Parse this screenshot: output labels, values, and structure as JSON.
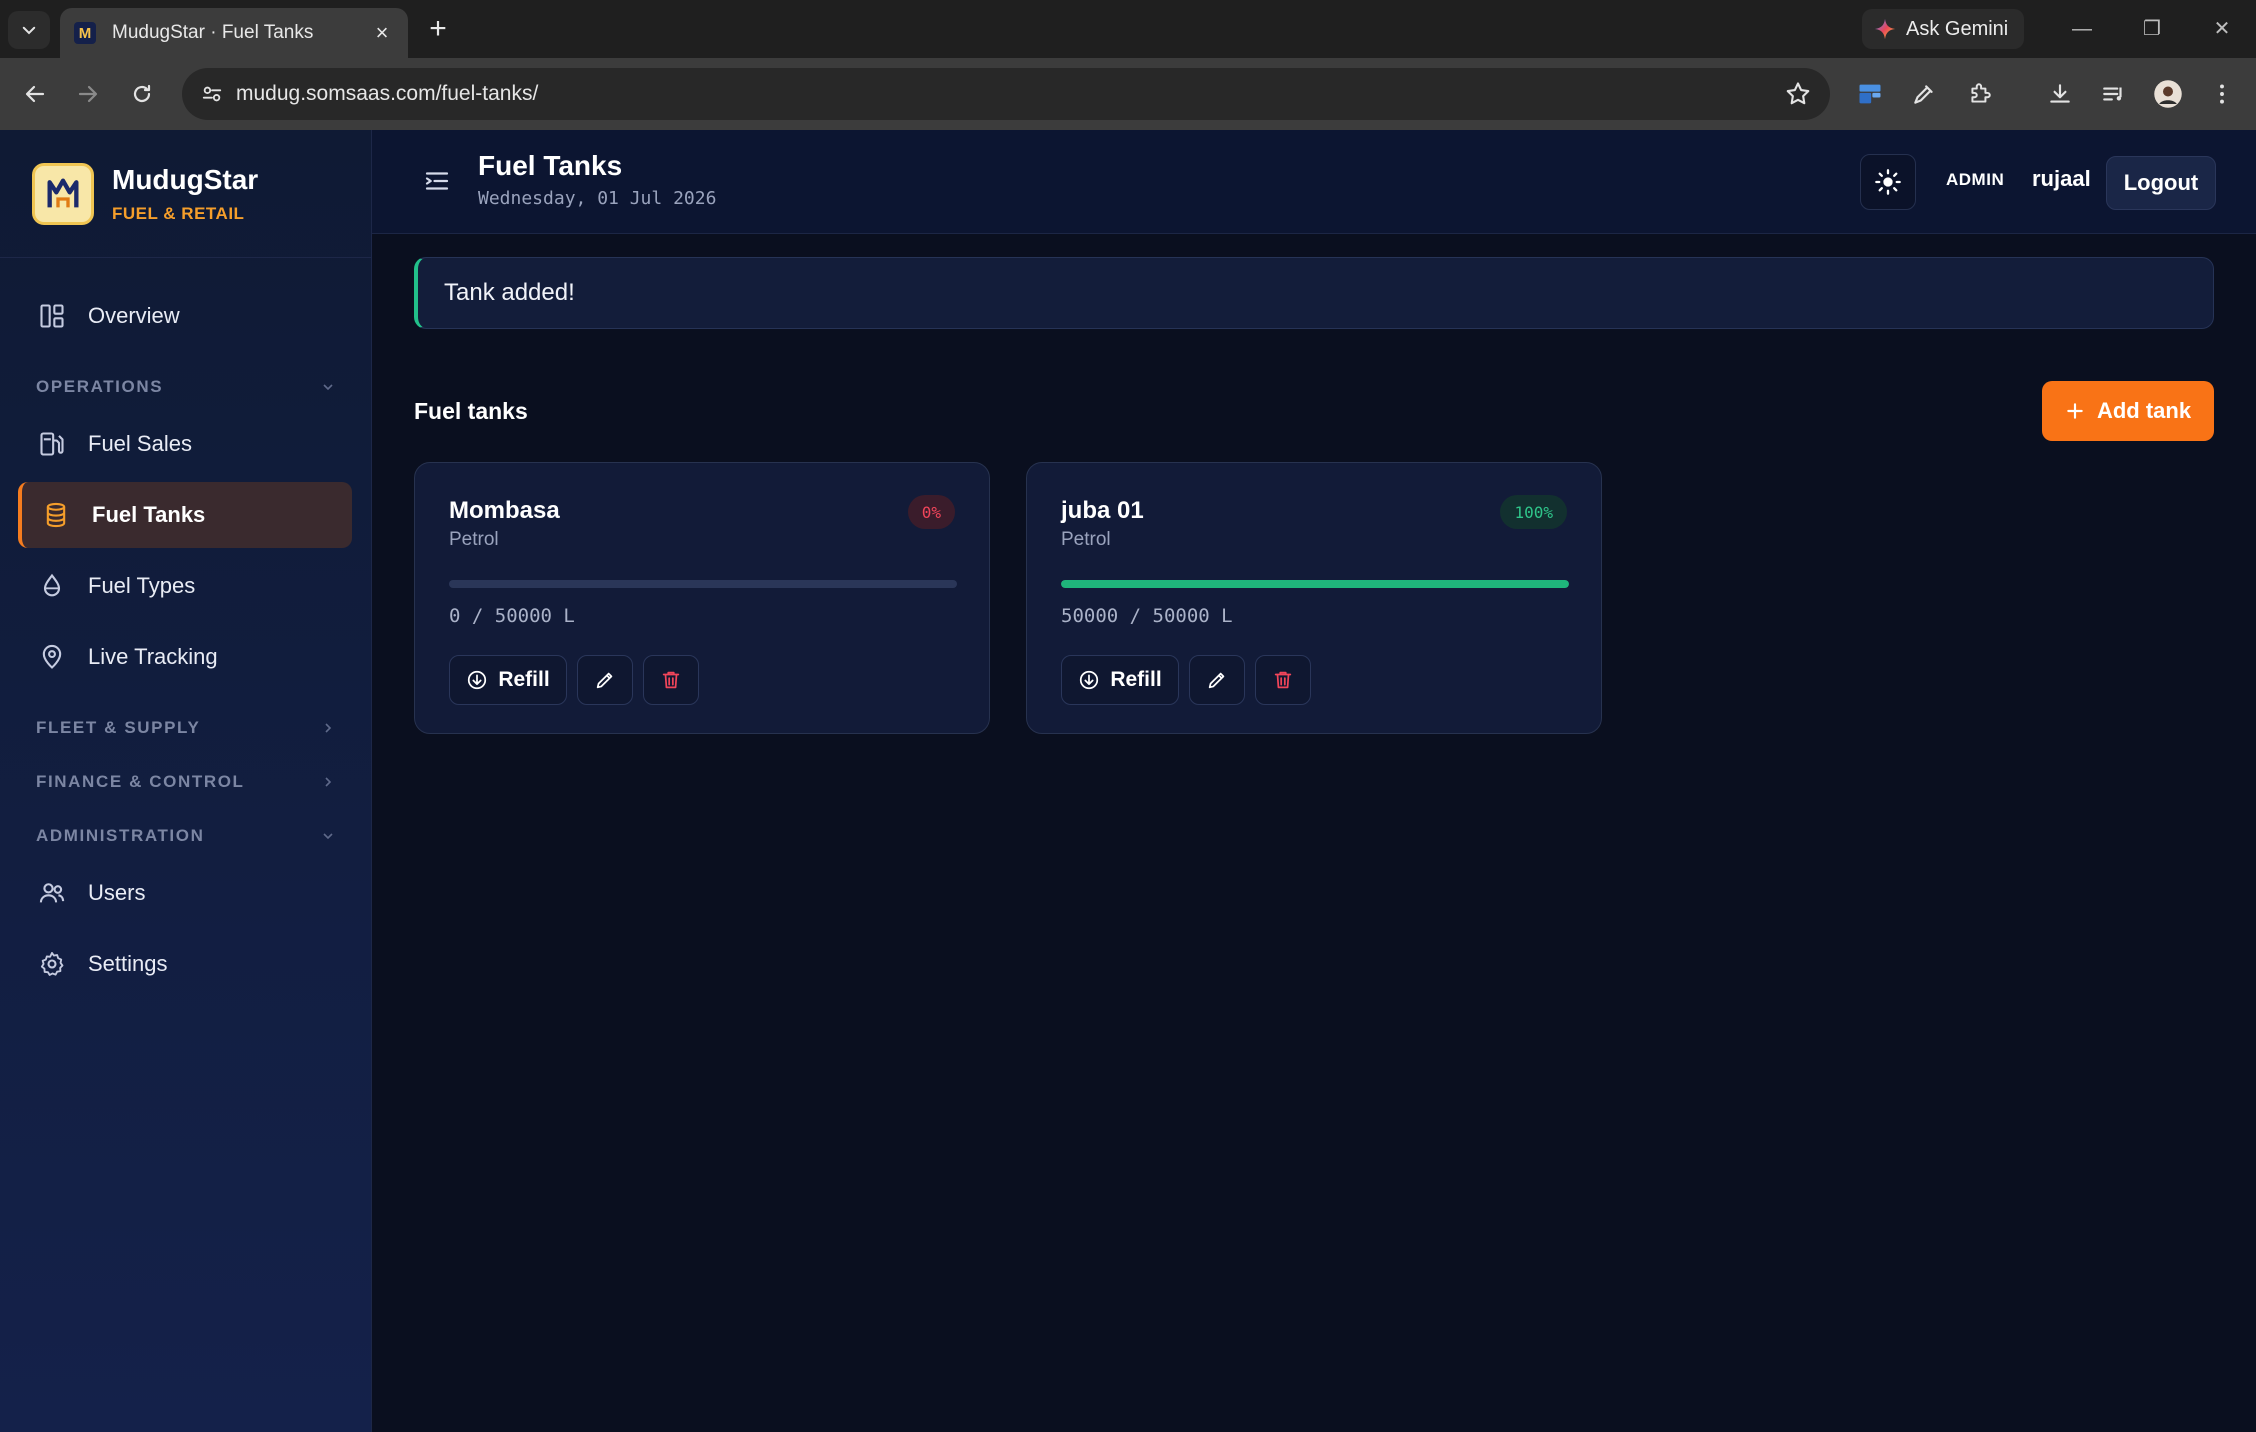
{
  "browser": {
    "tab_title": "MudugStar · Fuel Tanks",
    "favicon_letter": "M",
    "url": "mudug.somsaas.com/fuel-tanks/",
    "gemini_label": "Ask Gemini"
  },
  "sidebar": {
    "brand_name": "MudugStar",
    "brand_sub": "FUEL & RETAIL",
    "overview": "Overview",
    "section_operations": "OPERATIONS",
    "fuel_sales": "Fuel Sales",
    "fuel_tanks": "Fuel Tanks",
    "fuel_types": "Fuel Types",
    "live_tracking": "Live Tracking",
    "section_fleet": "FLEET & SUPPLY",
    "section_finance": "FINANCE & CONTROL",
    "section_admin": "ADMINISTRATION",
    "users": "Users",
    "settings": "Settings"
  },
  "header": {
    "title": "Fuel Tanks",
    "date": "Wednesday, 01 Jul 2026",
    "role": "ADMIN",
    "username": "rujaal",
    "logout": "Logout"
  },
  "alert": {
    "message": "Tank added!"
  },
  "main": {
    "section_title": "Fuel tanks",
    "add_button": "Add tank"
  },
  "tanks": [
    {
      "name": "Mombasa",
      "fuel_type": "Petrol",
      "percent_label": "0%",
      "fill_percent": 0,
      "capacity_label": "0 / 50000 L",
      "refill_label": "Refill"
    },
    {
      "name": "juba 01",
      "fuel_type": "Petrol",
      "percent_label": "100%",
      "fill_percent": 100,
      "capacity_label": "50000 / 50000 L",
      "refill_label": "Refill"
    }
  ],
  "colors": {
    "accent": "#f97316",
    "success": "#1fb57b",
    "danger": "#f0455a",
    "background": "#0a0f1f"
  }
}
